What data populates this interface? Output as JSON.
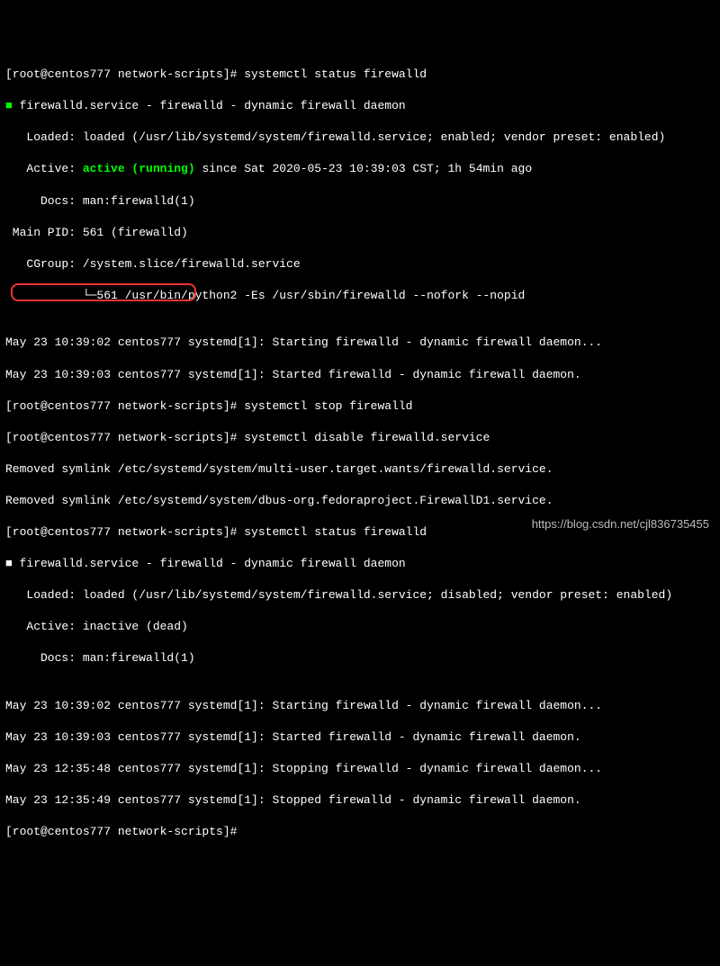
{
  "lines": {
    "l1_prompt": "[root@centos777 network-scripts]# systemctl status firewalld",
    "l2_bullet": "■",
    "l2_text": " firewalld.service - firewalld - dynamic firewall daemon",
    "l3": "   Loaded: loaded (/usr/lib/systemd/system/firewalld.service; enabled; vendor preset: enabled)",
    "l4_pre": "   Active: ",
    "l4_green": "active (running)",
    "l4_post": " since Sat 2020-05-23 10:39:03 CST; 1h 54min ago",
    "l5": "     Docs: man:firewalld(1)",
    "l6": " Main PID: 561 (firewalld)",
    "l7": "   CGroup: /system.slice/firewalld.service",
    "l8": "           └─561 /usr/bin/python2 -Es /usr/sbin/firewalld --nofork --nopid",
    "l9": "",
    "l10": "May 23 10:39:02 centos777 systemd[1]: Starting firewalld - dynamic firewall daemon...",
    "l11": "May 23 10:39:03 centos777 systemd[1]: Started firewalld - dynamic firewall daemon.",
    "l12": "[root@centos777 network-scripts]# systemctl stop firewalld",
    "l13": "[root@centos777 network-scripts]# systemctl disable firewalld.service",
    "l14": "Removed symlink /etc/systemd/system/multi-user.target.wants/firewalld.service.",
    "l15": "Removed symlink /etc/systemd/system/dbus-org.fedoraproject.FirewallD1.service.",
    "l16": "[root@centos777 network-scripts]# systemctl status firewalld",
    "l17_bullet": "■",
    "l17_text": " firewalld.service - firewalld - dynamic firewall daemon",
    "l18": "   Loaded: loaded (/usr/lib/systemd/system/firewalld.service; disabled; vendor preset: enabled)",
    "l19": "   Active: inactive (dead)",
    "l20": "     Docs: man:firewalld(1)",
    "l21": "",
    "l22": "May 23 10:39:02 centos777 systemd[1]: Starting firewalld - dynamic firewall daemon...",
    "l23": "May 23 10:39:03 centos777 systemd[1]: Started firewalld - dynamic firewall daemon.",
    "l24": "May 23 12:35:48 centos777 systemd[1]: Stopping firewalld - dynamic firewall daemon...",
    "l25": "May 23 12:35:49 centos777 systemd[1]: Stopped firewalld - dynamic firewall daemon.",
    "l26": "[root@centos777 network-scripts]# "
  },
  "watermark": "https://blog.csdn.net/cjl836735455"
}
